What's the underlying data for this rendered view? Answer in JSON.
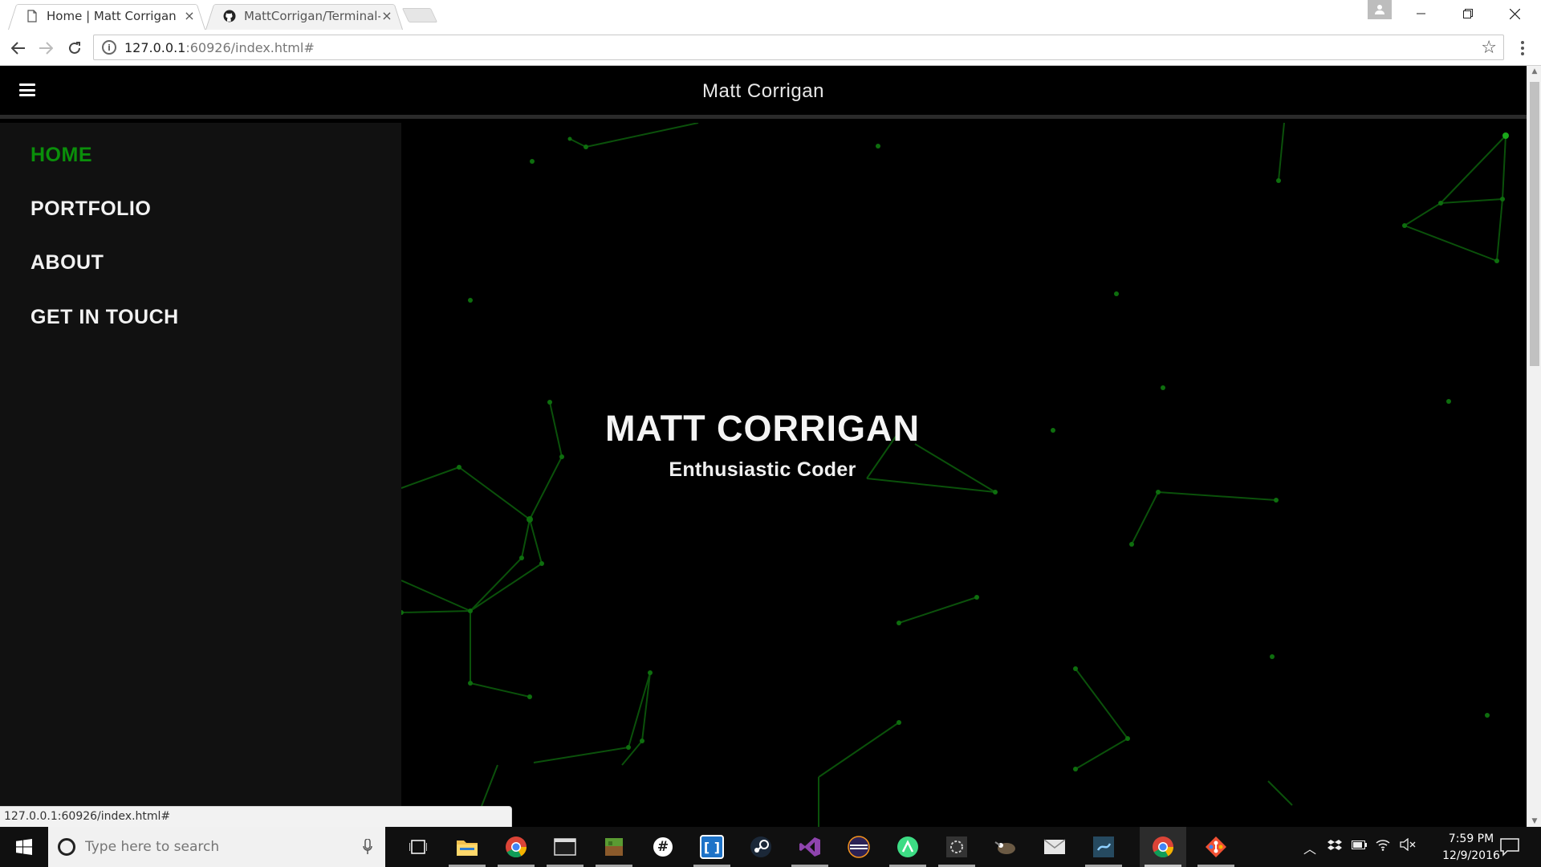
{
  "browser": {
    "tabs": [
      {
        "title": "Home | Matt Corrigan",
        "active": true
      },
      {
        "title": "MattCorrigan/Terminal-T",
        "active": false
      }
    ],
    "close_glyph": "×",
    "address": {
      "host": "127.0.0.1",
      "rest": ":60926/index.html#"
    },
    "status_url": "127.0.0.1:60926/index.html#"
  },
  "site": {
    "header_title": "Matt Corrigan",
    "nav": [
      {
        "label": "HOME",
        "active": true
      },
      {
        "label": "PORTFOLIO",
        "active": false
      },
      {
        "label": "ABOUT",
        "active": false
      },
      {
        "label": "GET IN TOUCH",
        "active": false
      }
    ],
    "hero": {
      "title": "MATT CORRIGAN",
      "subtitle": "Enthusiastic Coder"
    },
    "accent_color": "#0a8f0a",
    "particle_color": "#0c5a0c"
  },
  "taskbar": {
    "search_placeholder": "Type here to search",
    "apps": [
      {
        "name": "task-view",
        "color": "#101010"
      },
      {
        "name": "file-explorer",
        "color": "#f2c14e"
      },
      {
        "name": "chrome",
        "color": "#4285f4"
      },
      {
        "name": "terminal",
        "color": "#333333"
      },
      {
        "name": "minecraft",
        "color": "#5a9b32"
      },
      {
        "name": "slack",
        "color": "#ffffff"
      },
      {
        "name": "brackets",
        "color": "#1e73c8"
      },
      {
        "name": "steam",
        "color": "#1b2838"
      },
      {
        "name": "visual-studio",
        "color": "#68217a"
      },
      {
        "name": "eclipse",
        "color": "#2c2255"
      },
      {
        "name": "android-studio",
        "color": "#3ddc84"
      },
      {
        "name": "unity",
        "color": "#444444"
      },
      {
        "name": "gimp",
        "color": "#6b5a44"
      },
      {
        "name": "mail",
        "color": "#e6e6e6"
      },
      {
        "name": "sublime-text",
        "color": "#3b6b8c"
      },
      {
        "name": "chrome-active",
        "color": "#4285f4"
      },
      {
        "name": "git",
        "color": "#f05033"
      }
    ],
    "clock_time": "7:59 PM",
    "clock_date": "12/9/2016"
  }
}
